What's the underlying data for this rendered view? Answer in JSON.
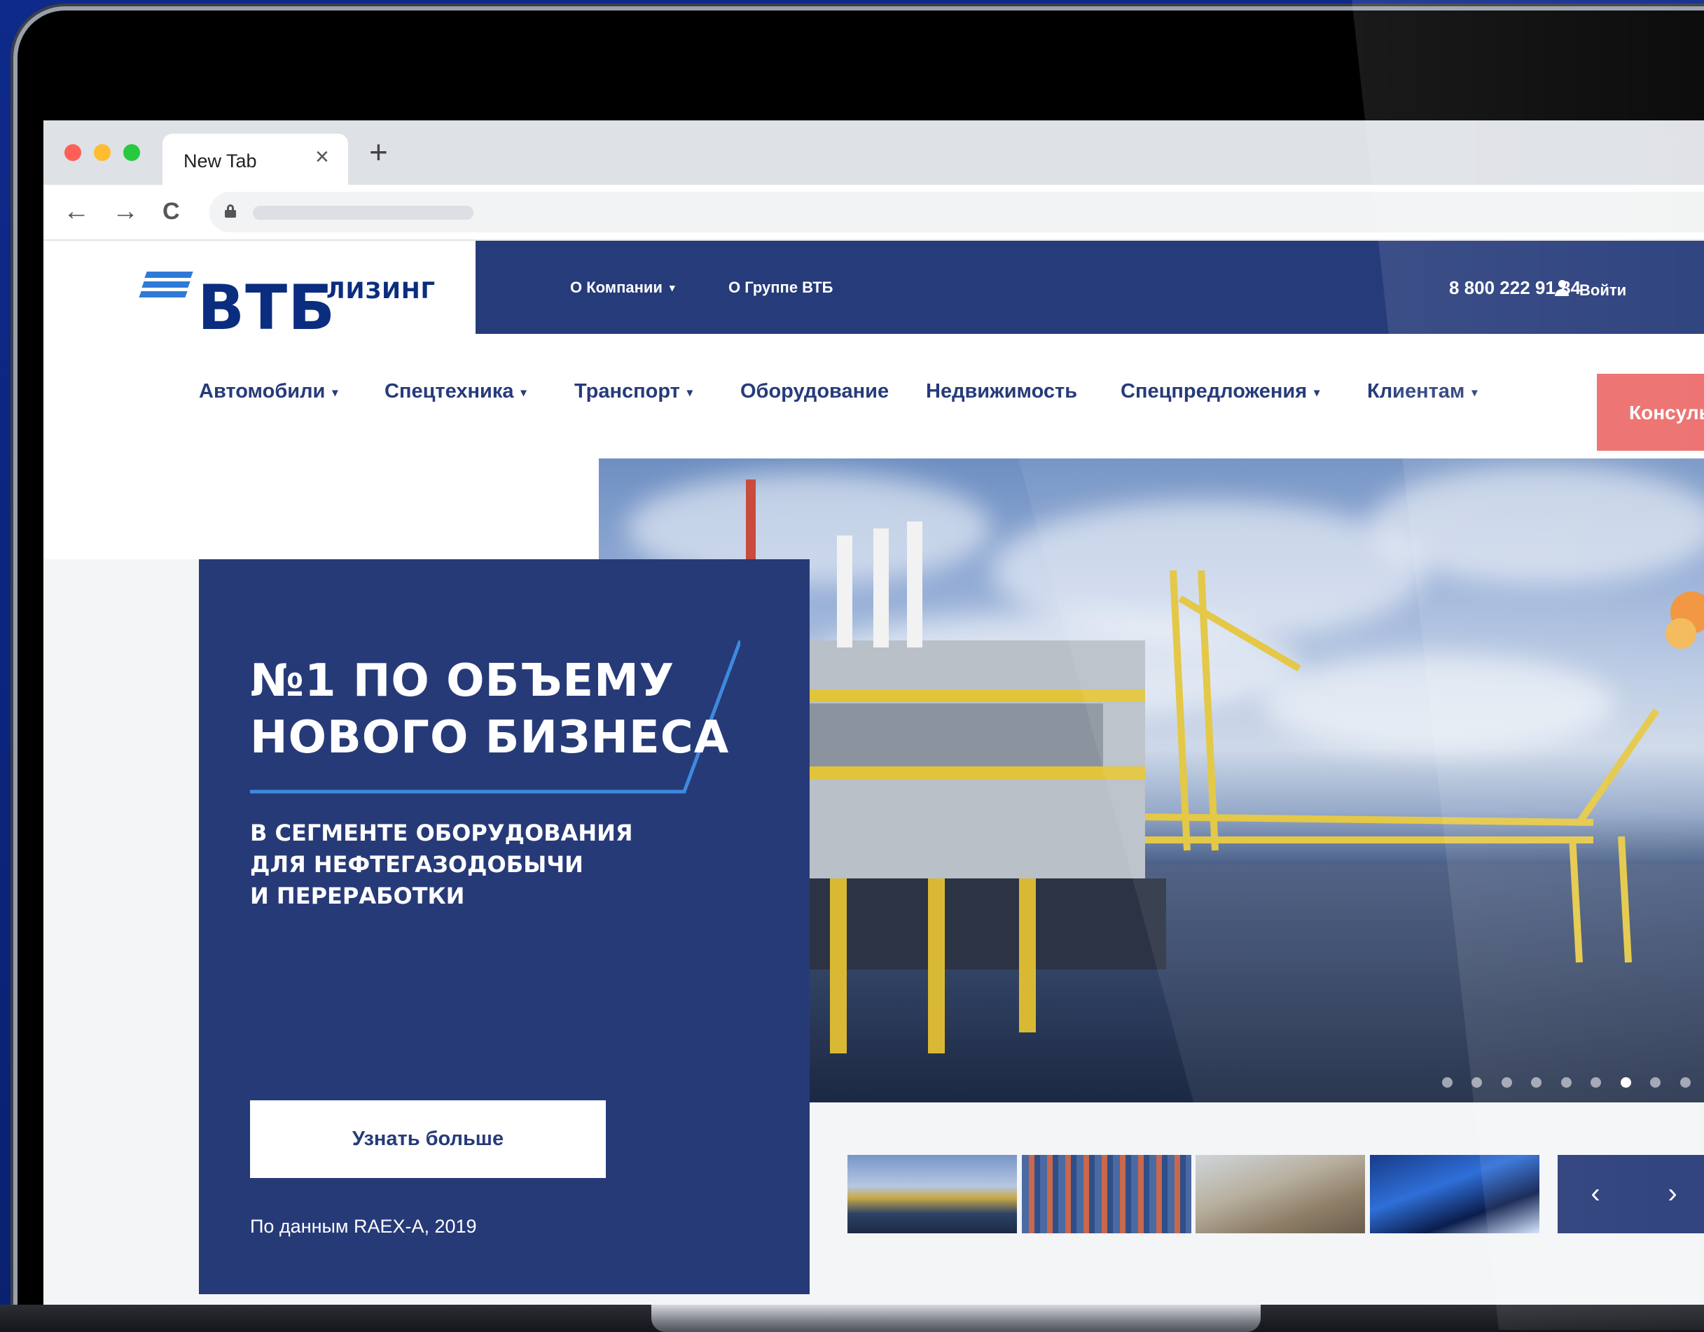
{
  "browser": {
    "tab_title": "New Tab",
    "tab_close": "×",
    "new_tab": "+",
    "back": "←",
    "forward": "→",
    "reload": "C"
  },
  "header": {
    "logo_text": "ВТБ",
    "logo_sub": "ЛИЗИНГ",
    "top_links": [
      {
        "label": "О Компании",
        "caret": "▾"
      },
      {
        "label": "О Группе ВТБ"
      }
    ],
    "phone": "8 800 222 91 84",
    "login": "Войти"
  },
  "menu": {
    "items": [
      {
        "label": "Автомобили",
        "caret": "▾"
      },
      {
        "label": "Спецтехника",
        "caret": "▾"
      },
      {
        "label": "Транспорт",
        "caret": "▾"
      },
      {
        "label": "Оборудование"
      },
      {
        "label": "Недвижимость"
      },
      {
        "label": "Спецпредложения",
        "caret": "▾"
      },
      {
        "label": "Клиентам",
        "caret": "▾"
      }
    ],
    "consult_label": "Консуль"
  },
  "hero": {
    "title_line1": "№1 ПО ОБЪЕМУ",
    "title_line2": "НОВОГО БИЗНЕСА",
    "subtitle_line1": "В СЕГМЕНТЕ ОБОРУДОВАНИЯ",
    "subtitle_line2": "ДЛЯ НЕФТЕГАЗОДОБЫЧИ",
    "subtitle_line3": "И ПЕРЕРАБОТКИ",
    "button_label": "Узнать больше",
    "source": "По данным RAEX-A, 2019"
  },
  "slider": {
    "prev": "‹",
    "next": "›",
    "active_dot": 6,
    "dot_count": 9
  },
  "colors": {
    "brand_navy": "#263b7a",
    "brand_blue": "#2f7ad8",
    "consult_red": "#ec6d6c"
  }
}
